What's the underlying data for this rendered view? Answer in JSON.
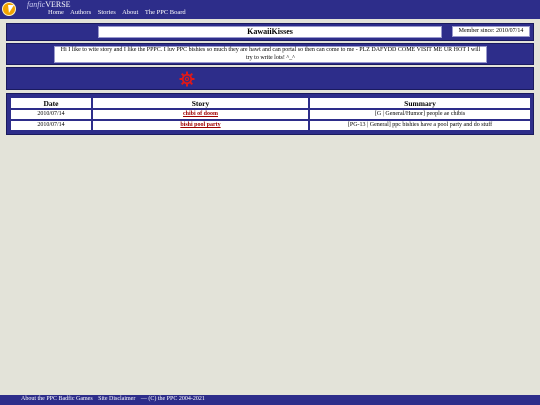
{
  "site": {
    "brand_prefix": "fanfic",
    "brand_name": "VERSE",
    "logo_icon": "lightning-bolt-icon",
    "nav": [
      "Home",
      "Authors",
      "Stories",
      "About",
      "The PPC Board"
    ]
  },
  "profile": {
    "name": "KawaiiKisses",
    "member_since": "Member since: 2010/07/14",
    "bio": "Hi I like to wite story and I like the PPPC. I luv PPC bishies so much they are hawt and can portal so then can come to me - PLZ DAFYDD COME VISIT ME UR HOT I will try to write lots! ^_^",
    "avatar_icon": "red-gear-icon",
    "colors": {
      "panel": "#2d2d8a",
      "link": "#a00000",
      "background": "#e3e3d9"
    }
  },
  "stories": {
    "headers": [
      "Date",
      "Story",
      "Summary"
    ],
    "rows": [
      {
        "date": "2010/07/14",
        "title": "chibi of doom",
        "summary": "[G | General/Humor] people ae chibis"
      },
      {
        "date": "2010/07/14",
        "title": "bishi pool party",
        "summary": "[PG-13 | General] ppc bishies have a pool party and do stuff"
      }
    ]
  },
  "footer": {
    "links": [
      "About the PPC Badfic Games",
      "Site Disclaimer"
    ],
    "copyright": "— (C) the PPC 2004-2021"
  }
}
